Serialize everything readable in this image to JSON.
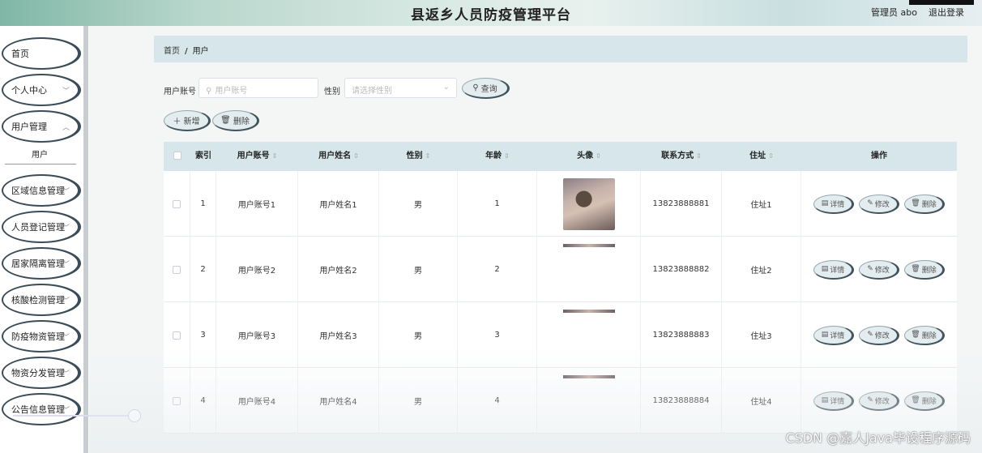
{
  "header": {
    "title": "县返乡人员防疫管理平台",
    "admin_label": "管理员 abo",
    "logout_label": "退出登录"
  },
  "sidebar": {
    "items": [
      {
        "label": "首页",
        "has_chevron": false
      },
      {
        "label": "个人中心",
        "has_chevron": true
      },
      {
        "label": "用户管理",
        "has_chevron": true
      },
      {
        "label": "区域信息管理",
        "has_chevron": true
      },
      {
        "label": "人员登记管理",
        "has_chevron": true
      },
      {
        "label": "居家隔离管理",
        "has_chevron": true
      },
      {
        "label": "核酸检测管理",
        "has_chevron": true
      },
      {
        "label": "防疫物资管理",
        "has_chevron": true
      },
      {
        "label": "物资分发管理",
        "has_chevron": true
      },
      {
        "label": "公告信息管理",
        "has_chevron": true
      }
    ],
    "submenu_label": "用户"
  },
  "breadcrumb": {
    "home": "首页",
    "separator": "/",
    "current": "用户"
  },
  "search": {
    "account_label": "用户账号",
    "account_placeholder": "用户账号",
    "gender_label": "性别",
    "gender_placeholder": "请选择性别",
    "query_label": "查询"
  },
  "actions": {
    "add_label": "新增",
    "delete_label": "删除"
  },
  "table": {
    "headers": [
      "索引",
      "用户账号",
      "用户姓名",
      "性别",
      "年龄",
      "头像",
      "联系方式",
      "住址",
      "操作"
    ],
    "rows": [
      {
        "index": "1",
        "account": "用户账号1",
        "name": "用户姓名1",
        "gender": "男",
        "age": "1",
        "phone": "13823888881",
        "address": "住址1"
      },
      {
        "index": "2",
        "account": "用户账号2",
        "name": "用户姓名2",
        "gender": "男",
        "age": "2",
        "phone": "13823888882",
        "address": "住址2"
      },
      {
        "index": "3",
        "account": "用户账号3",
        "name": "用户姓名3",
        "gender": "男",
        "age": "3",
        "phone": "13823888883",
        "address": "住址3"
      },
      {
        "index": "4",
        "account": "用户账号4",
        "name": "用户姓名4",
        "gender": "男",
        "age": "4",
        "phone": "13823888884",
        "address": "住址4"
      }
    ],
    "op_labels": {
      "detail": "详情",
      "edit": "修改",
      "delete": "删除"
    }
  },
  "watermark": "CSDN @嘉人Java毕设程序源码"
}
